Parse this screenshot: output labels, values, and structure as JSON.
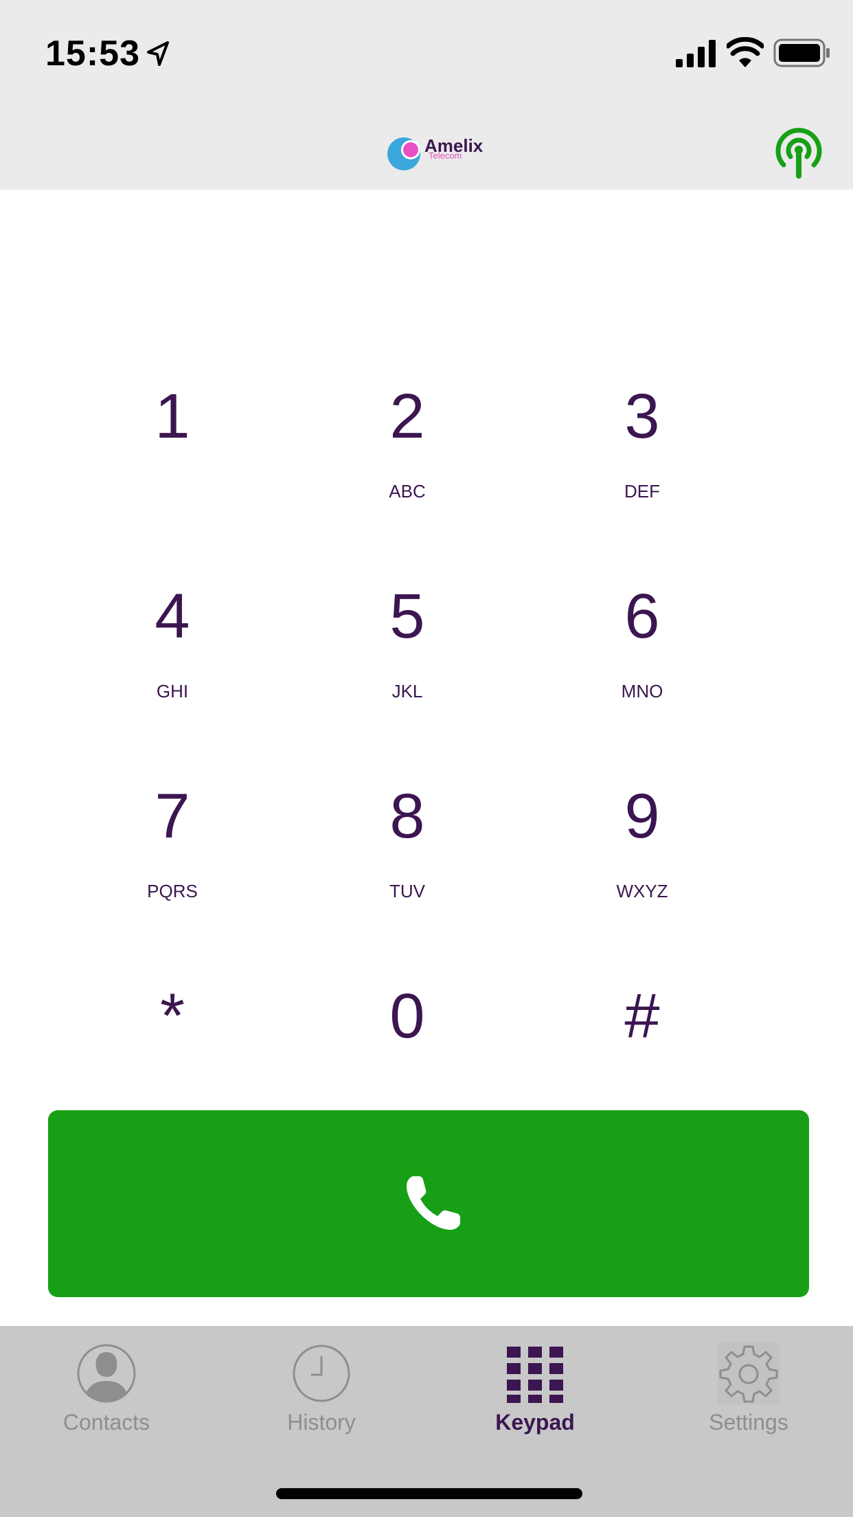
{
  "status_bar": {
    "time": "15:53",
    "icons": [
      "location-arrow-icon",
      "cellular-signal-icon",
      "wifi-icon",
      "battery-icon"
    ]
  },
  "header": {
    "logo_text": "Amelix",
    "logo_subtext": "Telecom",
    "status_icon": "broadcast-icon",
    "status_color": "#17a016"
  },
  "keypad": {
    "keys": [
      {
        "digit": "1",
        "letters": ""
      },
      {
        "digit": "2",
        "letters": "ABC"
      },
      {
        "digit": "3",
        "letters": "DEF"
      },
      {
        "digit": "4",
        "letters": "GHI"
      },
      {
        "digit": "5",
        "letters": "JKL"
      },
      {
        "digit": "6",
        "letters": "MNO"
      },
      {
        "digit": "7",
        "letters": "PQRS"
      },
      {
        "digit": "8",
        "letters": "TUV"
      },
      {
        "digit": "9",
        "letters": "WXYZ"
      },
      {
        "digit": "*",
        "letters": ""
      },
      {
        "digit": "0",
        "letters": ""
      },
      {
        "digit": "#",
        "letters": ""
      }
    ],
    "text_color": "#3b1650"
  },
  "call_button": {
    "icon": "phone-icon",
    "color": "#17a016"
  },
  "tabbar": {
    "tabs": [
      {
        "label": "Contacts",
        "icon": "contact-icon",
        "active": false
      },
      {
        "label": "History",
        "icon": "clock-icon",
        "active": false
      },
      {
        "label": "Keypad",
        "icon": "keypad-grid-icon",
        "active": true
      },
      {
        "label": "Settings",
        "icon": "gear-icon",
        "active": false
      }
    ],
    "active_color": "#3b1650",
    "inactive_color": "#8e8e8e"
  }
}
